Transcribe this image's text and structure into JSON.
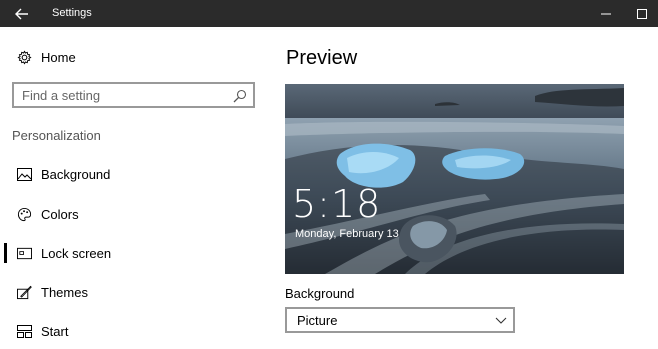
{
  "titlebar": {
    "title": "Settings",
    "back_icon": "arrow-left-icon",
    "minimize_icon": "minimize-icon",
    "maximize_icon": "maximize-icon",
    "bg_color": "#2b2b2b"
  },
  "sidebar": {
    "home_label": "Home",
    "search_placeholder": "Find a setting",
    "section_title": "Personalization",
    "items": [
      {
        "label": "Background",
        "icon": "picture-icon",
        "selected": false
      },
      {
        "label": "Colors",
        "icon": "palette-icon",
        "selected": false
      },
      {
        "label": "Lock screen",
        "icon": "lock-screen-icon",
        "selected": true
      },
      {
        "label": "Themes",
        "icon": "themes-icon",
        "selected": false
      },
      {
        "label": "Start",
        "icon": "start-icon",
        "selected": false
      }
    ]
  },
  "main": {
    "title": "Preview",
    "lock_preview": {
      "time": "5:18",
      "date": "Monday, February 13"
    },
    "background_label": "Background",
    "background_value": "Picture"
  }
}
